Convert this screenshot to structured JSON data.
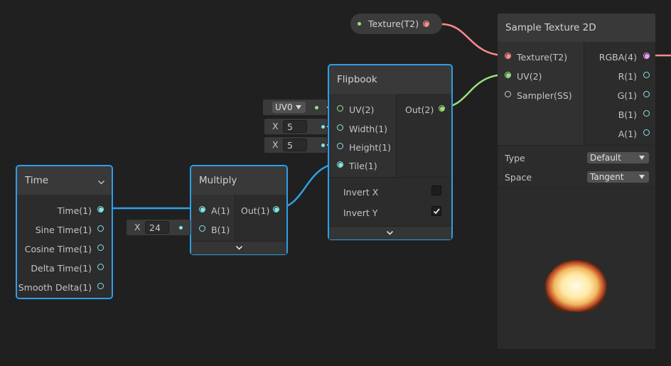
{
  "texture_property": {
    "label": "Texture(T2)"
  },
  "sample_texture": {
    "title": "Sample Texture 2D",
    "inputs": [
      "Texture(T2)",
      "UV(2)",
      "Sampler(SS)"
    ],
    "outputs": [
      "RGBA(4)",
      "R(1)",
      "G(1)",
      "B(1)",
      "A(1)"
    ],
    "type_label": "Type",
    "type_value": "Default",
    "space_label": "Space",
    "space_value": "Tangent",
    "preview_icon": "explosion-fire-preview"
  },
  "flipbook": {
    "title": "Flipbook",
    "inputs": [
      "UV(2)",
      "Width(1)",
      "Height(1)",
      "Tile(1)"
    ],
    "output": "Out(2)",
    "invert_x_label": "Invert X",
    "invert_x": false,
    "invert_y_label": "Invert Y",
    "invert_y": true,
    "uv_default": "UV0",
    "width_axis": "X",
    "width_value": "5",
    "height_axis": "X",
    "height_value": "5"
  },
  "multiply": {
    "title": "Multiply",
    "inputs": [
      "A(1)",
      "B(1)"
    ],
    "output": "Out(1)",
    "b_axis": "X",
    "b_value": "24"
  },
  "time": {
    "title": "Time",
    "outputs": [
      "Time(1)",
      "Sine Time(1)",
      "Cosine Time(1)",
      "Delta Time(1)",
      "Smooth Delta(1)"
    ]
  },
  "colors": {
    "selection": "#2e9fe6",
    "float_port": "#84e4e7",
    "vector2_port": "#9be07e",
    "texture_port": "#ff8b8b",
    "vector4_port": "#e9a3ef"
  }
}
